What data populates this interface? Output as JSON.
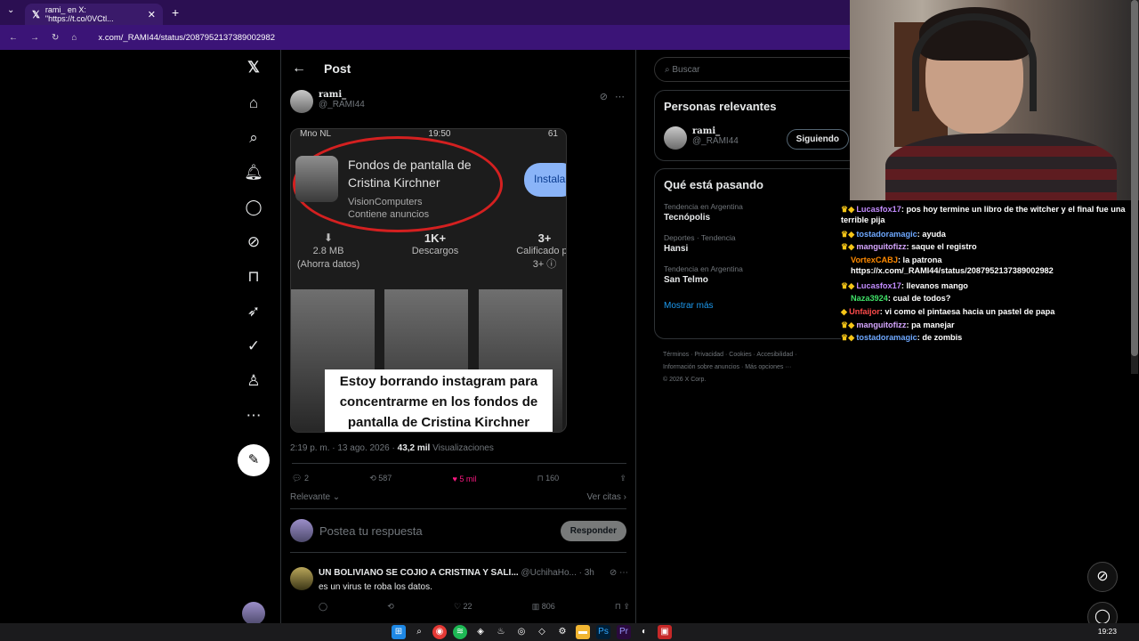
{
  "browser": {
    "tab_title": "rami_ en X: \"https://t.co/0VCtl...",
    "url": "x.com/_RAMI44/status/2087952137389002982"
  },
  "post": {
    "header": "Post",
    "author_name": "rami_",
    "author_handle": "@_RAMI44",
    "screenshot": {
      "status_left": "Mno NL",
      "status_time": "19:50",
      "status_right": "61",
      "app_title": "Fondos de pantalla de Cristina Kirchner",
      "app_dev": "VisionComputers",
      "app_ads": "Contiene anuncios",
      "install": "Instala",
      "stat1_val": "2.8 MB",
      "stat1_sub": "(Ahorra datos)",
      "stat2_val": "1K+",
      "stat2_sub": "Descargos",
      "stat3_val": "3+",
      "stat3_sub": "Calificado pa",
      "stat3_sub2": "3+ ⓘ",
      "caption": "Estoy borrando instagram para concentrarme en los fondos de pantalla de Cristina Kirchner"
    },
    "meta_time": "2:19 p. m. · 13 ago. 2026 ·",
    "views_count": "43,2 mil",
    "views_label": "Visualizaciones",
    "replies": "2",
    "retweets": "587",
    "likes": "5 mil",
    "bookmarks": "160",
    "sort_label": "Relevante",
    "quotes_label": "Ver citas",
    "reply_placeholder": "Postea tu respuesta",
    "reply_button": "Responder"
  },
  "comment": {
    "name": "UN BOLIVIANO SE COJIO A CRISTINA Y SALI...",
    "handle": "@UchihaHo...",
    "time": "· 3h",
    "text": "es un virus te roba los datos.",
    "likes": "22",
    "views": "806"
  },
  "sidebar": {
    "search_placeholder": "Buscar",
    "relevant_title": "Personas relevantes",
    "rel_name": "rami_",
    "rel_handle": "@_RAMI44",
    "follow_label": "Siguiendo",
    "trending_title": "Qué está pasando",
    "trends": [
      {
        "label": "Tendencia en Argentina",
        "name": "Tecnópolis"
      },
      {
        "label": "Deportes · Tendencia",
        "name": "Hansi"
      },
      {
        "label": "Tendencia en Argentina",
        "name": "San Telmo"
      }
    ],
    "show_more": "Mostrar más",
    "footer1": "Términos · Privacidad · Cookies · Accesibilidad ·",
    "footer2": "Información sobre anuncios · Más opciones ···",
    "footer3": "© 2026 X Corp."
  },
  "chat": [
    {
      "user": "Lucasfox17",
      "color": "#c38cff",
      "text": ": pos hoy termine un libro de the witcher y el final fue una terrible pija"
    },
    {
      "user": "tostadoramagic",
      "color": "#6ea8ff",
      "text": ": ayuda"
    },
    {
      "user": "manguitofizz",
      "color": "#d6a6ff",
      "text": ": saque el registro"
    },
    {
      "user": "VortexCABJ",
      "color": "#ff8a00",
      "text": ": la patrona https://x.com/_RAMI44/status/2087952137389002982"
    },
    {
      "user": "Lucasfox17",
      "color": "#c38cff",
      "text": ": llevanos mango"
    },
    {
      "user": "Naza3924",
      "color": "#3fe067",
      "text": ": cual de todos?"
    },
    {
      "user": "Unfaijor",
      "color": "#ff4b4b",
      "text": ": vi como el pintaesa hacia un pastel de papa"
    },
    {
      "user": "manguitofizz",
      "color": "#d6a6ff",
      "text": ": pa manejar"
    },
    {
      "user": "tostadoramagic",
      "color": "#6ea8ff",
      "text": ": de zombis"
    }
  ],
  "taskbar": {
    "time": "19:23"
  }
}
